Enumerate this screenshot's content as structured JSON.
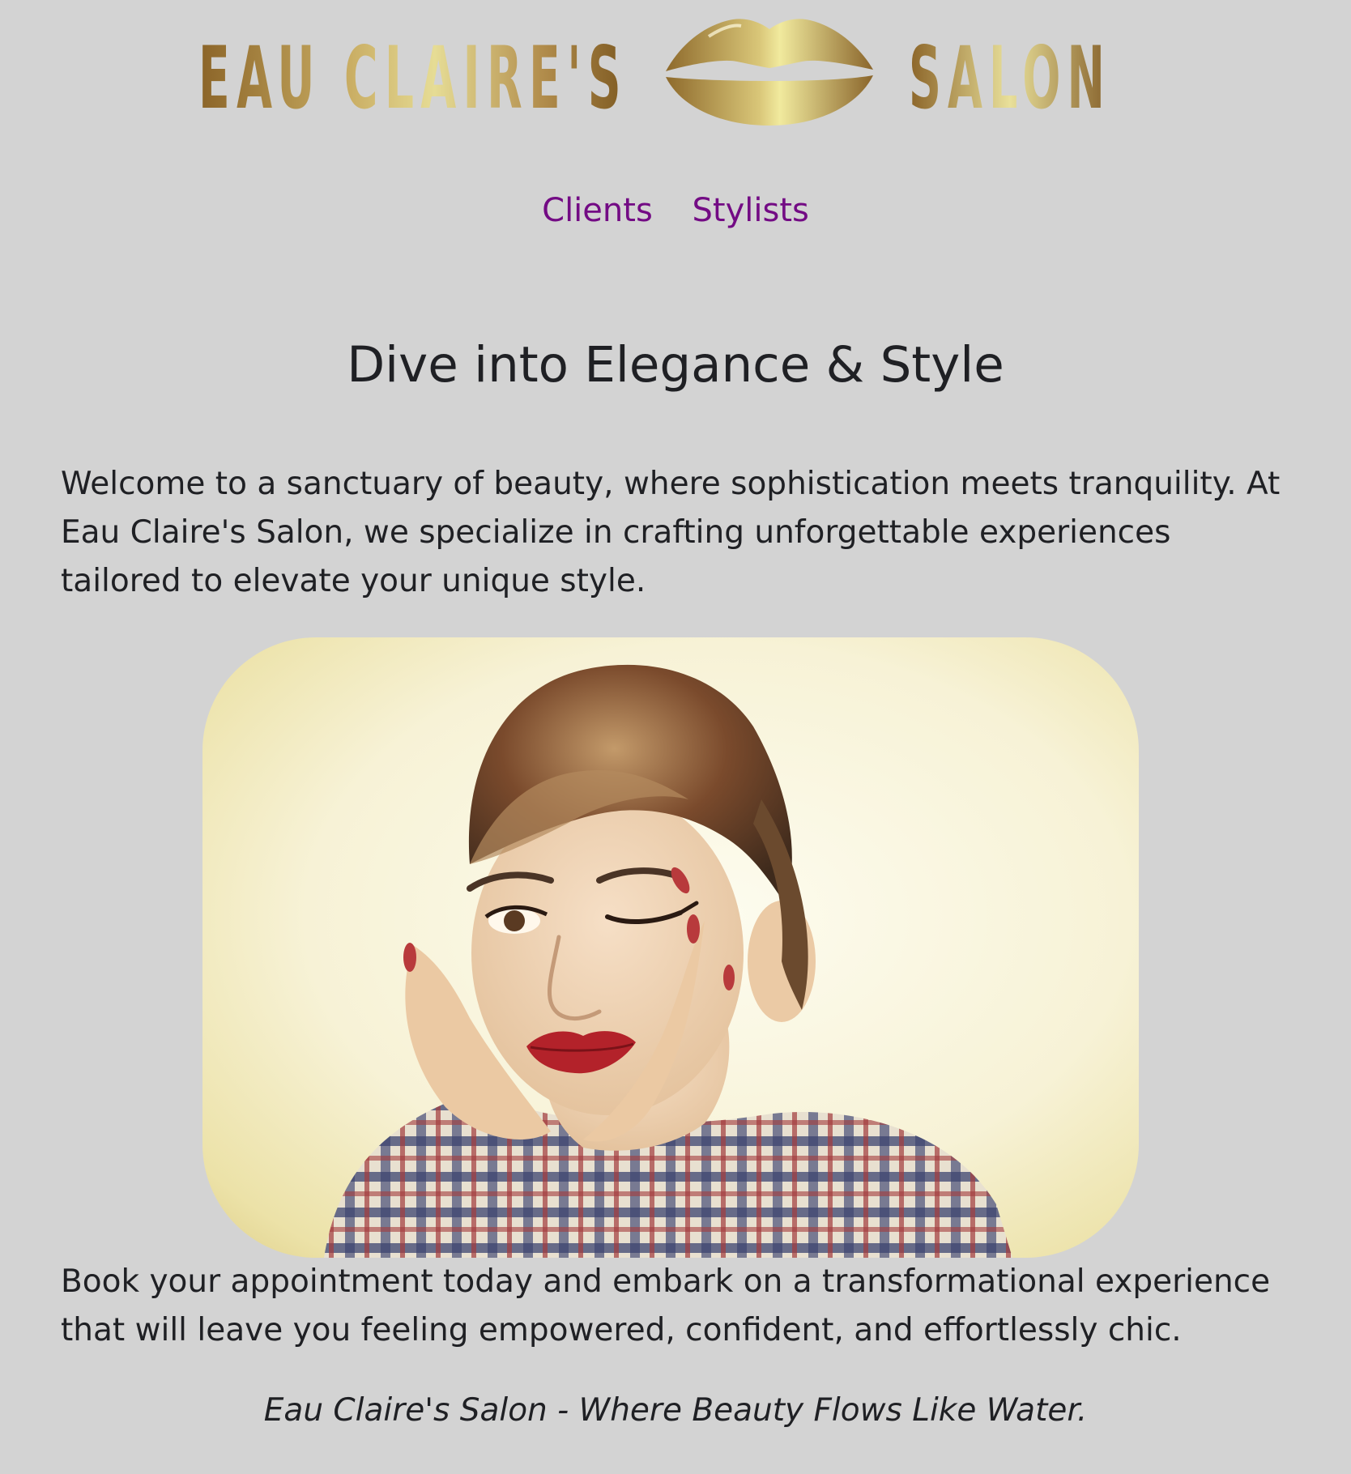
{
  "logo": {
    "name_left": "EAU CLAIRE'S",
    "name_right": "SALON",
    "icon": "lips-icon"
  },
  "nav": {
    "items": [
      {
        "label": "Clients"
      },
      {
        "label": "Stylists"
      }
    ]
  },
  "main": {
    "heading": "Dive into Elegance & Style",
    "intro": "Welcome to a sanctuary of beauty, where sophistication meets tranquility. At Eau Claire's Salon, we specialize in crafting unforgettable experiences tailored to elevate your unique style.",
    "booking": "Book your appointment today and embark on a transformational experience that will leave you feeling empowered, confident, and effortlessly chic.",
    "tagline": "Eau Claire's Salon - Where Beauty Flows Like Water."
  },
  "colors": {
    "background": "#d3d3d3",
    "nav_link": "#730b84",
    "text": "#1f2024",
    "gold_dark": "#8b6428",
    "gold_light": "#efe79a"
  }
}
